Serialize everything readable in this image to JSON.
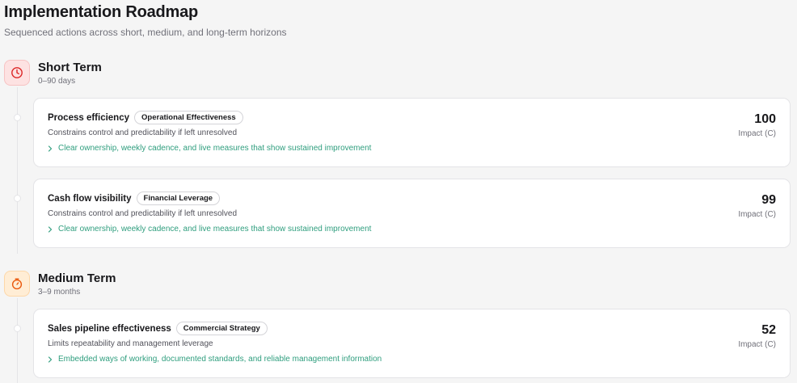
{
  "header": {
    "title": "Implementation Roadmap",
    "subtitle": "Sequenced actions across short, medium, and long-term horizons"
  },
  "colors": {
    "short_term_accent": "#dc2626",
    "medium_term_accent": "#ea580c",
    "action_text": "#2f9e7e"
  },
  "sections": [
    {
      "title": "Short Term",
      "range": "0–90 days",
      "icon": "clock-icon",
      "items": [
        {
          "title": "Process efficiency",
          "tag": "Operational Effectiveness",
          "description": "Constrains control and predictability if left unresolved",
          "action": "Clear ownership, weekly cadence, and live measures that show sustained improvement",
          "score": "100",
          "score_label": "Impact (C)"
        },
        {
          "title": "Cash flow visibility",
          "tag": "Financial Leverage",
          "description": "Constrains control and predictability if left unresolved",
          "action": "Clear ownership, weekly cadence, and live measures that show sustained improvement",
          "score": "99",
          "score_label": "Impact (C)"
        }
      ]
    },
    {
      "title": "Medium Term",
      "range": "3–9 months",
      "icon": "stopwatch-icon",
      "items": [
        {
          "title": "Sales pipeline effectiveness",
          "tag": "Commercial Strategy",
          "description": "Limits repeatability and management leverage",
          "action": "Embedded ways of working, documented standards, and reliable management information",
          "score": "52",
          "score_label": "Impact (C)"
        }
      ]
    }
  ]
}
